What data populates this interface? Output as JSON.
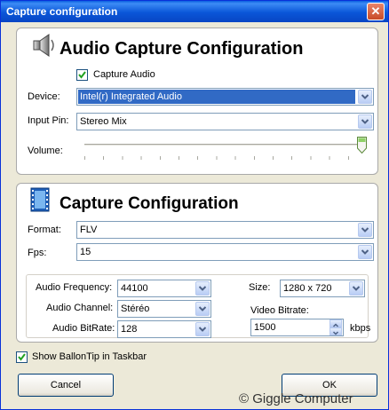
{
  "window": {
    "title": "Capture configuration",
    "close_glyph": "✕"
  },
  "audio": {
    "heading": "Audio Capture Configuration",
    "capture_audio_label": "Capture Audio",
    "capture_audio_checked": true,
    "device_label": "Device:",
    "device_value": "Intel(r) Integrated Audio",
    "input_pin_label": "Input Pin:",
    "input_pin_value": "Stereo Mix",
    "volume_label": "Volume:",
    "volume_level": 1.0
  },
  "capture": {
    "heading": "Capture Configuration",
    "format_label": "Format:",
    "format_value": "FLV",
    "fps_label": "Fps:",
    "fps_value": "15",
    "audio_frequency_label": "Audio Frequency:",
    "audio_frequency_value": "44100",
    "audio_channel_label": "Audio Channel:",
    "audio_channel_value": "Stéréo",
    "audio_bitrate_label": "Audio BitRate:",
    "audio_bitrate_value": "128",
    "size_label": "Size:",
    "size_value": "1280 x 720",
    "video_bitrate_label": "Video Bitrate:",
    "video_bitrate_value": "1500",
    "video_bitrate_unit": "kbps"
  },
  "balloon": {
    "label": "Show BallonTip in Taskbar",
    "checked": true
  },
  "buttons": {
    "cancel": "Cancel",
    "ok": "OK"
  },
  "watermark": "© Giggle Computer",
  "icons": {
    "audio": "speaker-icon",
    "capture": "film-strip-icon"
  },
  "colors": {
    "titlebar": "#0a56d8",
    "selection": "#316ac5",
    "window_bg": "#ece9d8"
  }
}
